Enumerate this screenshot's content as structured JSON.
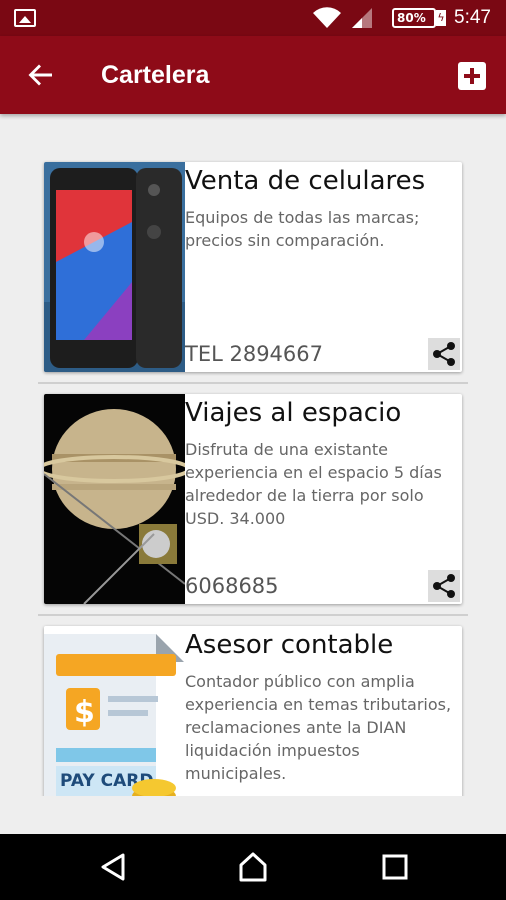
{
  "status_bar": {
    "battery": "80%",
    "time": "5:47"
  },
  "app_bar": {
    "title": "Cartelera"
  },
  "listings": [
    {
      "title": "Venta de celulares",
      "description": "Equipos de todas las marcas; precios sin comparación.",
      "phone": "TEL 2894667",
      "image": "phone-image"
    },
    {
      "title": "Viajes al espacio",
      "description": "Disfruta de una existante experiencia en el espacio 5 días alrededor de la tierra por solo USD. 34.000",
      "phone": "6068685",
      "image": "saturn-probe-image"
    },
    {
      "title": "Asesor contable",
      "description": "Contador público con amplia experiencia en temas tributarios, reclamaciones ante la DIAN liquidación impuestos municipales.",
      "phone": "",
      "image": "pay-card-image",
      "image_text": "PAY CARD"
    }
  ],
  "icons": {
    "back": "arrow-back-icon",
    "add": "add-box-icon",
    "share": "share-icon",
    "nav_back": "triangle-back-icon",
    "nav_home": "circle-home-icon",
    "nav_recents": "square-recents-icon"
  },
  "colors": {
    "status_bar": "#7a0813",
    "app_bar": "#8e0b18",
    "background": "#eeeeee"
  }
}
